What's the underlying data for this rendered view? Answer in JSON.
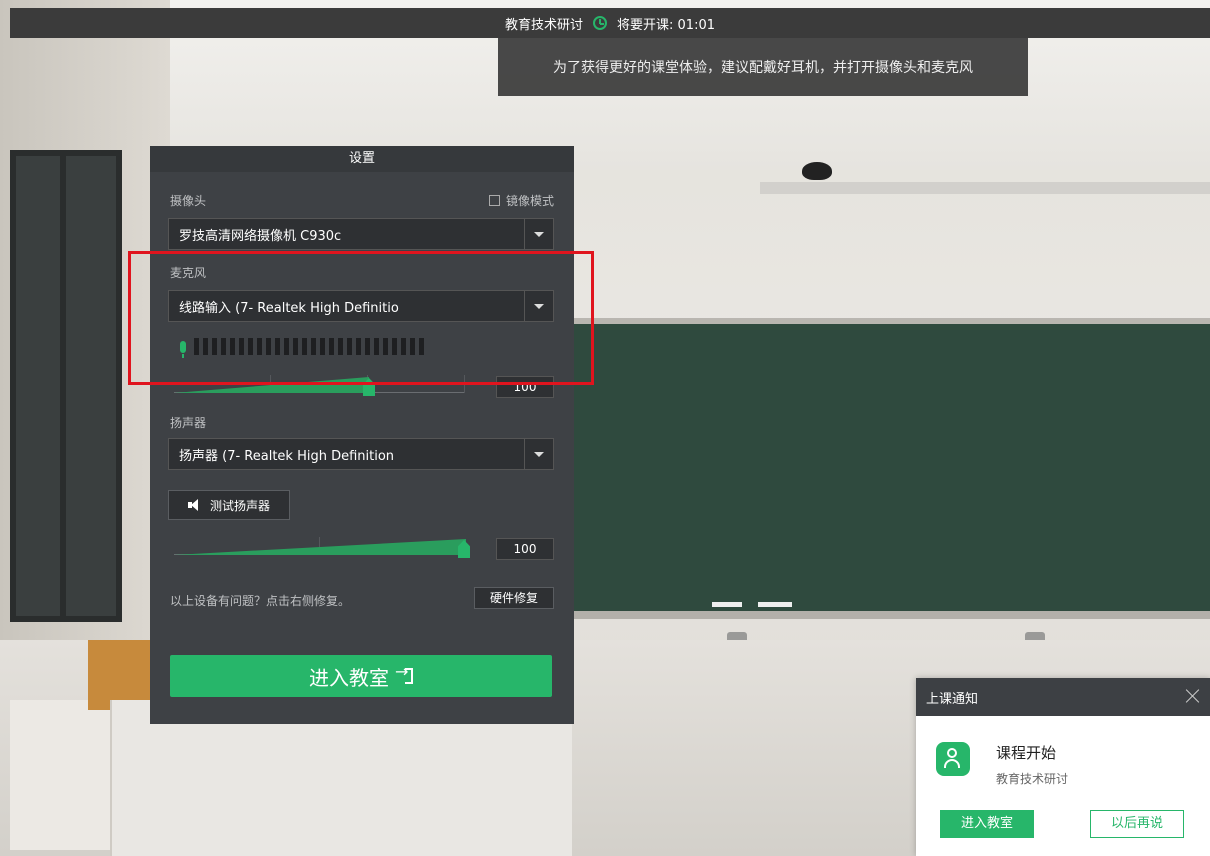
{
  "topbar": {
    "course": "教育技术研讨",
    "status": "将要开课: 01:01"
  },
  "hint": "为了获得更好的课堂体验，建议配戴好耳机，并打开摄像头和麦克风",
  "settings": {
    "title": "设置",
    "camera_label": "摄像头",
    "mirror_label": "镜像模式",
    "mirror_checked": false,
    "camera_value": "罗技高清网络摄像机 C930c",
    "mic_label": "麦克风",
    "mic_value": "线路输入 (7- Realtek High Definitio",
    "mic_level_segments": 26,
    "mic_volume": "100",
    "speaker_label": "扬声器",
    "speaker_value": "扬声器 (7- Realtek High Definition",
    "test_speaker": "测试扬声器",
    "speaker_volume": "100",
    "issue_text": "以上设备有问题？点击右侧修复。",
    "fix_button": "硬件修复",
    "enter_button": "进入教室"
  },
  "notification": {
    "header": "上课通知",
    "title": "课程开始",
    "course": "教育技术研讨",
    "enter": "进入教室",
    "later": "以后再说"
  },
  "colors": {
    "accent": "#27b66a",
    "panel": "#3e4145",
    "highlight": "#e0141e"
  }
}
